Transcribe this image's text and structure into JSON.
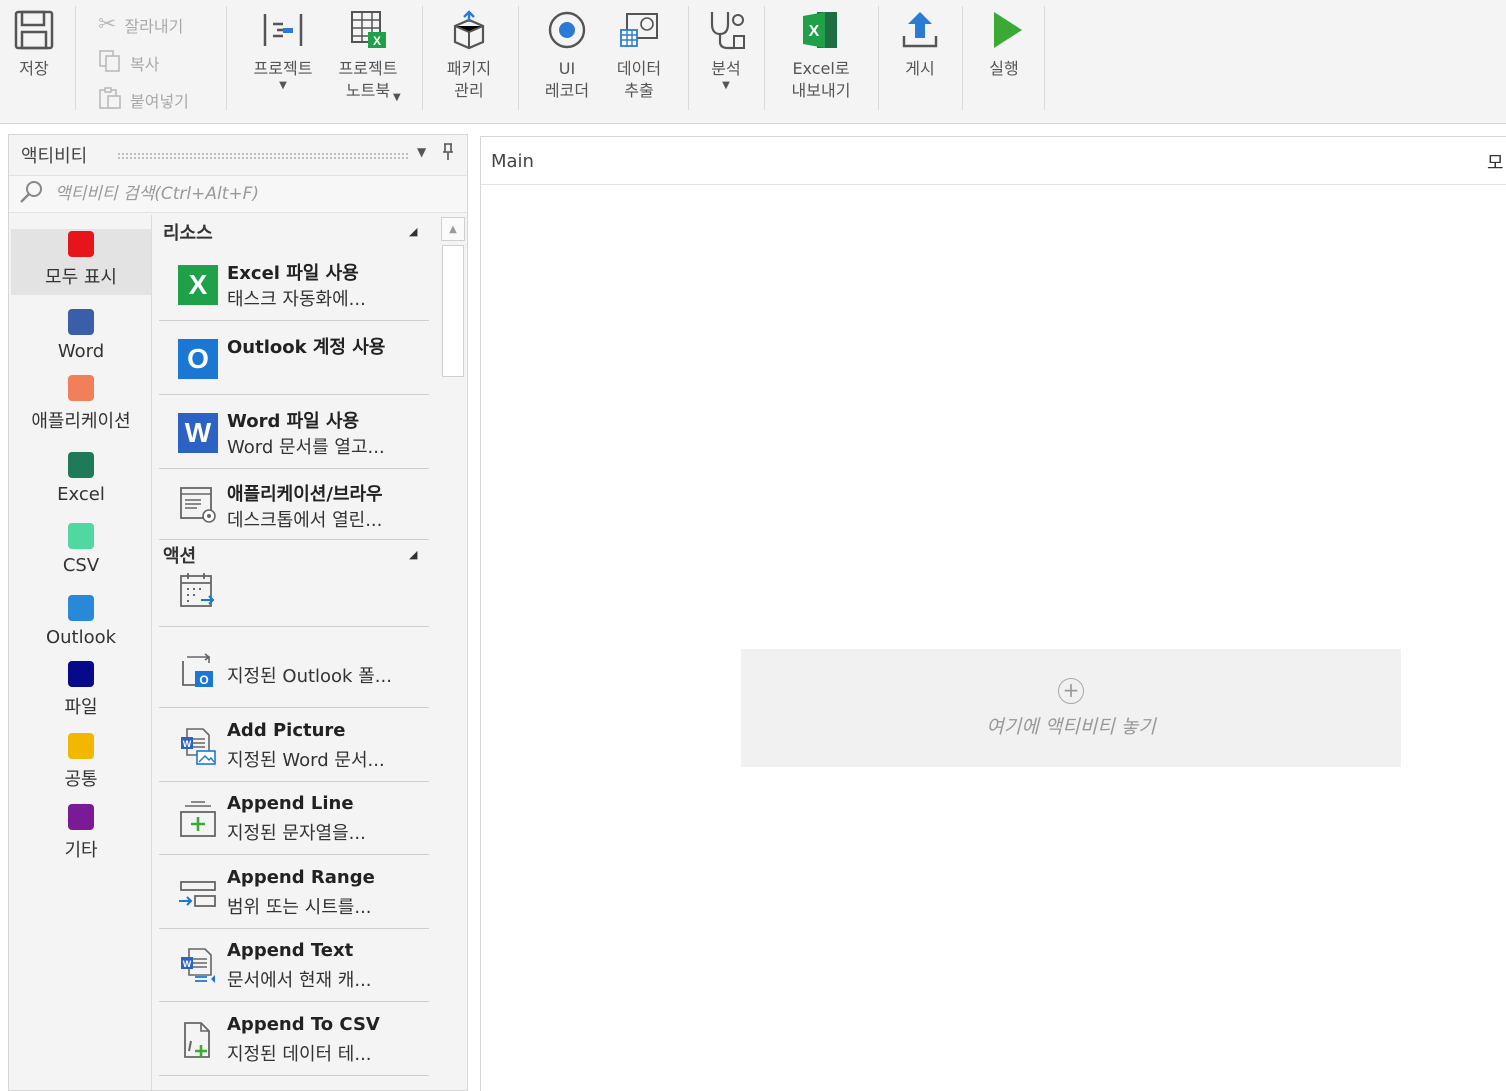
{
  "ribbon": {
    "save": "저장",
    "cut": "잘라내기",
    "copy": "복사",
    "paste": "붙여넣기",
    "project": "프로젝트",
    "project_notebook": "프로젝트\n노트북",
    "package": "패키지\n관리",
    "ui_recorder": "UI\n레코더",
    "data_extract": "데이터\n추출",
    "analyze": "분석",
    "export_excel": "Excel로\n내보내기",
    "publish": "게시",
    "run": "실행"
  },
  "panel": {
    "title": "액티비티",
    "search_placeholder": "액티비티 검색(Ctrl+Alt+F)"
  },
  "categories": [
    {
      "label": "모두 표시",
      "color": "#e8141c"
    },
    {
      "label": "Word",
      "color": "#3a5fa8"
    },
    {
      "label": "애플리케이션",
      "color": "#f07f5a"
    },
    {
      "label": "Excel",
      "color": "#1f7a5a"
    },
    {
      "label": "CSV",
      "color": "#4fd8a0"
    },
    {
      "label": "Outlook",
      "color": "#2a88d8"
    },
    {
      "label": "파일",
      "color": "#060a8a"
    },
    {
      "label": "공통",
      "color": "#f2b800"
    },
    {
      "label": "기타",
      "color": "#7a1a96"
    }
  ],
  "sections": {
    "resources": "리소스",
    "actions": "액션"
  },
  "resources": [
    {
      "title": "Excel 파일 사용",
      "desc": "태스크 자동화에...",
      "icon": "excel-tile-icon",
      "color": "#21a04a",
      "glyph": "X"
    },
    {
      "title": "Outlook 계정 사용",
      "desc": "",
      "icon": "outlook-tile-icon",
      "color": "#1a78d4",
      "glyph": "O"
    },
    {
      "title": "Word 파일 사용",
      "desc": "Word 문서를 열고...",
      "icon": "word-tile-icon",
      "color": "#2b62c4",
      "glyph": "W"
    },
    {
      "title": "애플리케이션/브라우",
      "desc": "데스크톱에서 열린...",
      "icon": "app-browser-icon"
    }
  ],
  "actions": [
    {
      "title": "",
      "desc": "",
      "icon": "calendar-arrow-icon"
    },
    {
      "title": "",
      "desc": "지정된 Outlook 폴...",
      "icon": "outlook-move-icon"
    },
    {
      "title": "Add Picture",
      "desc": "지정된 Word 문서...",
      "icon": "word-picture-icon"
    },
    {
      "title": "Append Line",
      "desc": "지정된 문자열을...",
      "icon": "append-line-icon"
    },
    {
      "title": "Append Range",
      "desc": "범위 또는 시트를...",
      "icon": "append-range-icon"
    },
    {
      "title": "Append Text",
      "desc": "문서에서 현재 캐...",
      "icon": "append-text-icon"
    },
    {
      "title": "Append To CSV",
      "desc": "지정된 데이터 테...",
      "icon": "append-csv-icon"
    }
  ],
  "designer": {
    "tab": "Main",
    "cut_tab": "모",
    "drop_hint": "여기에 액티비티 놓기"
  },
  "colors": {
    "accent_green": "#3aaa35",
    "accent_blue": "#1a78d4"
  }
}
